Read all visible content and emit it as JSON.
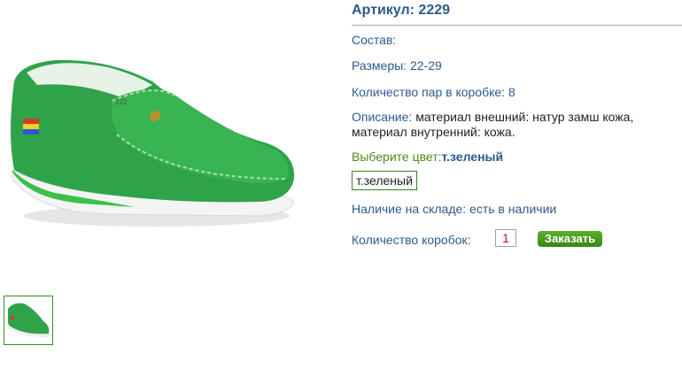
{
  "product": {
    "sku": "Артикул: 2229",
    "composition_label": "Состав:",
    "sizes": "Размеры: 22-29",
    "pairs_per_box": "Количество пар в коробке: 8",
    "description_label": "Описание:",
    "description_text": "материал внешний: натур замш кожа, материал внутренний: кожа.",
    "color_prompt": "Выберите цвет:",
    "color_selected": "т.зеленый",
    "color_option": "т.зеленый",
    "stock": "Наличие на складе: есть в наличии",
    "box_qty_label": "Количество коробок:",
    "box_qty_value": "1",
    "order_button": "Заказать",
    "shoe_sole_text": "222"
  },
  "colors": {
    "accent_blue": "#2c5a8c",
    "accent_green": "#4e8a1e",
    "shoe_green": "#2fa34a",
    "button_green": "#3a8515"
  }
}
